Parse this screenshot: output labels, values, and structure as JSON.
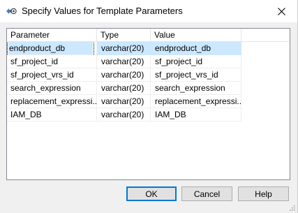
{
  "window": {
    "title": "Specify Values for Template Parameters",
    "icon": "template-parameters-icon",
    "close_icon": "close-icon"
  },
  "grid": {
    "columns": [
      "Parameter",
      "Type",
      "Value"
    ],
    "rows": [
      {
        "parameter": "endproduct_db",
        "type": "varchar(20)",
        "value": "endproduct_db",
        "selected": true
      },
      {
        "parameter": "sf_project_id",
        "type": "varchar(20)",
        "value": "sf_project_id"
      },
      {
        "parameter": "sf_project_vrs_id",
        "type": "varchar(20)",
        "value": "sf_project_vrs_id"
      },
      {
        "parameter": "search_expression",
        "type": "varchar(20)",
        "value": "search_expression"
      },
      {
        "parameter": "replacement_expressi...",
        "type": "varchar(20)",
        "value": "replacement_expressi..."
      },
      {
        "parameter": "IAM_DB",
        "type": "varchar(20)",
        "value": "IAM_DB"
      }
    ]
  },
  "buttons": {
    "ok": "OK",
    "cancel": "Cancel",
    "help": "Help"
  },
  "colors": {
    "selection": "#cce8ff",
    "default_button_border": "#0078d7",
    "background": "#f0f0f0"
  }
}
